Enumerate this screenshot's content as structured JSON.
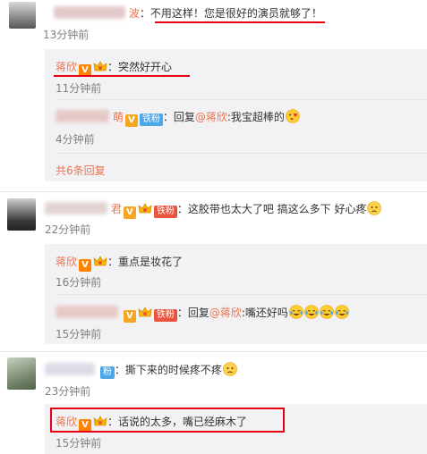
{
  "c1": {
    "name_tail": "波",
    "text": "：不用这样！您是很好的演员就够了！",
    "time": "13分钟前",
    "reply1": {
      "name": "蒋欣",
      "text": "：突然好开心",
      "time": "11分钟前"
    },
    "reply2": {
      "name_tail": "萌",
      "fan": "铁粉",
      "reply_word": "：回复",
      "at": "@蒋欣",
      "text": ":我宝超棒的",
      "time": "4分钟前"
    },
    "more": "共6条回复"
  },
  "c2": {
    "name_tail": "君",
    "fan": "铁粉",
    "text": "：这胶带也太大了吧  搞这么多下  好心疼",
    "time": "22分钟前",
    "reply1": {
      "name": "蒋欣",
      "text": "：重点是妆花了",
      "time": "16分钟前"
    },
    "reply2": {
      "fan": "铁粉",
      "reply_word": "：回复",
      "at": "@蒋欣",
      "text": ":嘴还好吗",
      "time": "15分钟前"
    }
  },
  "c3": {
    "fan": "粉",
    "text": "：撕下来的时候疼不疼",
    "time": "23分钟前",
    "reply1": {
      "name": "蒋欣",
      "text": "：话说的太多，嘴已经麻木了",
      "time": "15分钟前"
    }
  },
  "colors": {
    "accent": "#eb7350",
    "highlight": "#e60012",
    "reply_bg": "#f2f2f5"
  },
  "icons": [
    "verified-v-icon",
    "crown-icon",
    "tear-laugh-emoji",
    "heart-kiss-emoji",
    "sad-emoji"
  ]
}
